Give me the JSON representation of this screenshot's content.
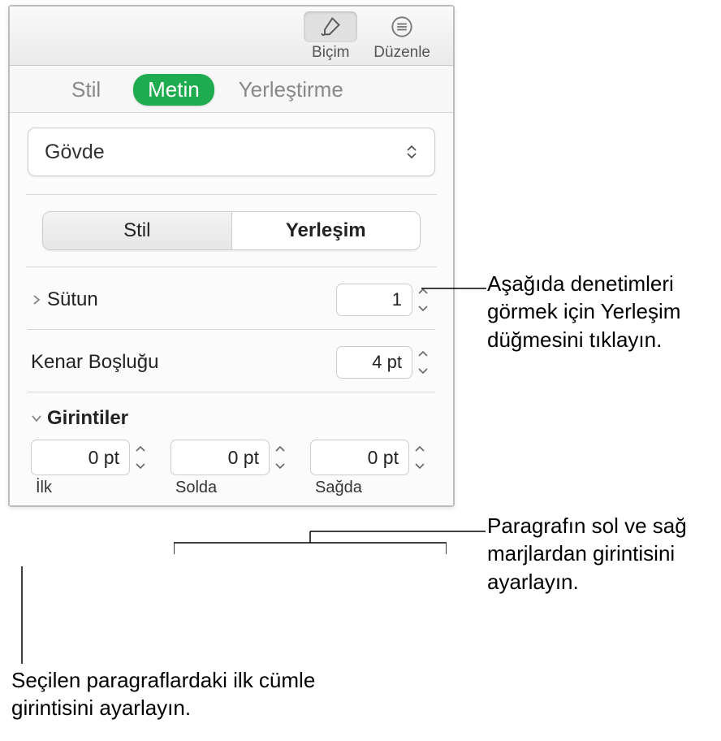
{
  "toolbar": {
    "format_label": "Biçim",
    "edit_label": "Düzenle"
  },
  "main_tabs": {
    "style": "Stil",
    "text": "Metin",
    "placement": "Yerleştirme"
  },
  "paragraph_style": {
    "value": "Gövde"
  },
  "sub_tabs": {
    "style": "Stil",
    "layout": "Yerleşim"
  },
  "columns": {
    "label": "Sütun",
    "value": "1"
  },
  "margin": {
    "label": "Kenar Boşluğu",
    "value": "4 pt"
  },
  "indents": {
    "header": "Girintiler",
    "first": {
      "value": "0 pt",
      "label": "İlk"
    },
    "left": {
      "value": "0 pt",
      "label": "Solda"
    },
    "right": {
      "value": "0 pt",
      "label": "Sağda"
    }
  },
  "callouts": {
    "layout_btn": "Aşağıda denetimleri görmek için Yerleşim düğmesini tıklayın.",
    "lr_indent": "Paragrafın sol ve sağ marjlardan girintisini ayarlayın.",
    "first_indent": "Seçilen paragraflardaki ilk cümle girintisini ayarlayın."
  }
}
